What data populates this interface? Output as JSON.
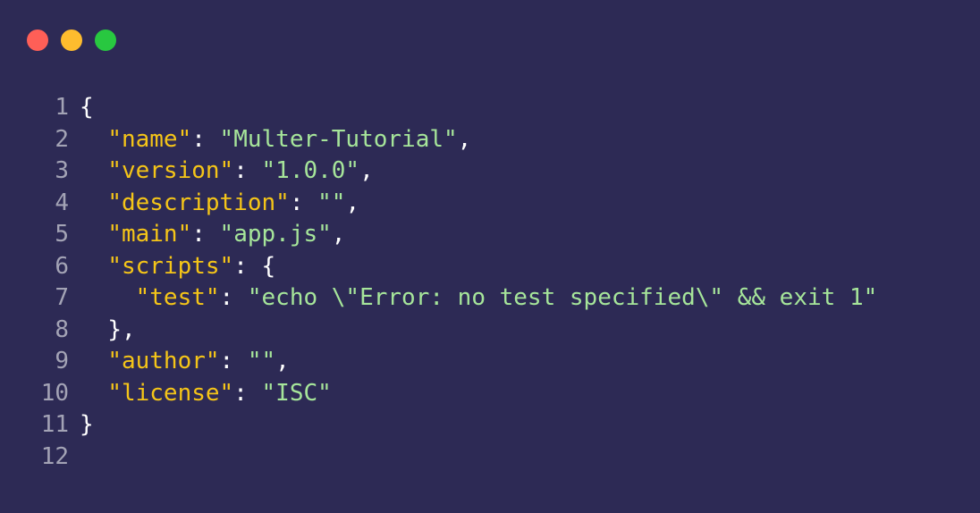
{
  "window": {
    "controls": [
      {
        "name": "close",
        "color": "#fe5f57"
      },
      {
        "name": "minimize",
        "color": "#febc2e"
      },
      {
        "name": "maximize",
        "color": "#28c840"
      }
    ]
  },
  "code": {
    "lines": [
      {
        "num": "1",
        "indent": "",
        "key": "",
        "sep": "",
        "value": "",
        "tail": "{"
      },
      {
        "num": "2",
        "indent": "  ",
        "key": "\"name\"",
        "sep": ": ",
        "value": "\"Multer-Tutorial\"",
        "tail": ","
      },
      {
        "num": "3",
        "indent": "  ",
        "key": "\"version\"",
        "sep": ": ",
        "value": "\"1.0.0\"",
        "tail": ","
      },
      {
        "num": "4",
        "indent": "  ",
        "key": "\"description\"",
        "sep": ": ",
        "value": "\"\"",
        "tail": ","
      },
      {
        "num": "5",
        "indent": "  ",
        "key": "\"main\"",
        "sep": ": ",
        "value": "\"app.js\"",
        "tail": ","
      },
      {
        "num": "6",
        "indent": "  ",
        "key": "\"scripts\"",
        "sep": ": ",
        "value": "",
        "tail": "{"
      },
      {
        "num": "7",
        "indent": "    ",
        "key": "\"test\"",
        "sep": ": ",
        "value": "\"echo \\\"Error: no test specified\\\" && exit 1\"",
        "tail": ""
      },
      {
        "num": "8",
        "indent": "  ",
        "key": "",
        "sep": "",
        "value": "",
        "tail": "},"
      },
      {
        "num": "9",
        "indent": "  ",
        "key": "\"author\"",
        "sep": ": ",
        "value": "\"\"",
        "tail": ","
      },
      {
        "num": "10",
        "indent": "  ",
        "key": "\"license\"",
        "sep": ": ",
        "value": "\"ISC\"",
        "tail": ""
      },
      {
        "num": "11",
        "indent": "",
        "key": "",
        "sep": "",
        "value": "",
        "tail": "}"
      },
      {
        "num": "12",
        "indent": "",
        "key": "",
        "sep": "",
        "value": "",
        "tail": ""
      }
    ]
  }
}
